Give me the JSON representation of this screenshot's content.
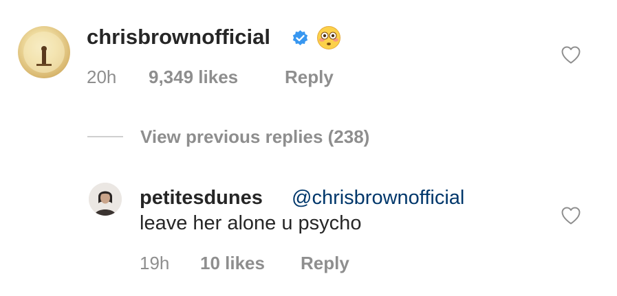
{
  "comment": {
    "username": "chrisbrownofficial",
    "verified": true,
    "text_emoji": "flushed-face",
    "time": "20h",
    "likes": "9,349 likes",
    "reply_label": "Reply",
    "liked": false
  },
  "replies_toggle": {
    "label": "View previous replies (238)"
  },
  "reply": {
    "username": "petitesdunes",
    "mention": "@chrisbrownofficial",
    "text": "leave her alone u psycho",
    "time": "19h",
    "likes": "10 likes",
    "reply_label": "Reply",
    "liked": false
  },
  "colors": {
    "text": "#262626",
    "meta": "#8e8e8e",
    "mention": "#00376b",
    "verified": "#3897f0"
  }
}
